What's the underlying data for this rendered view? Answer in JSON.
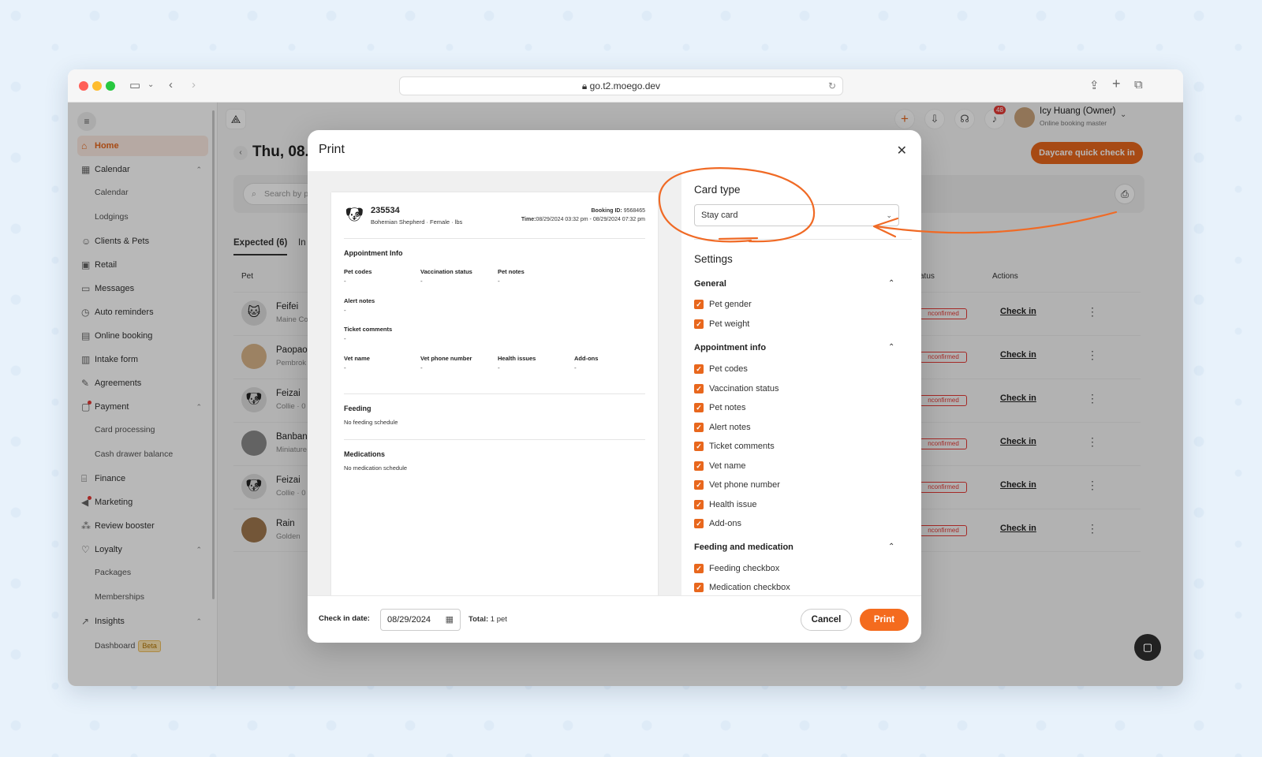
{
  "browser": {
    "url": "go.t2.moego.dev"
  },
  "sidebar": {
    "items": [
      {
        "label": "Home",
        "icon": "home-icon"
      },
      {
        "label": "Calendar",
        "icon": "calendar-icon"
      },
      {
        "label": "Clients & Pets",
        "icon": "users-icon"
      },
      {
        "label": "Retail",
        "icon": "retail-icon"
      },
      {
        "label": "Messages",
        "icon": "message-icon"
      },
      {
        "label": "Auto reminders",
        "icon": "alarm-icon"
      },
      {
        "label": "Online booking",
        "icon": "booking-icon"
      },
      {
        "label": "Intake form",
        "icon": "form-icon"
      },
      {
        "label": "Agreements",
        "icon": "pen-icon"
      },
      {
        "label": "Payment",
        "icon": "payment-icon"
      },
      {
        "label": "Finance",
        "icon": "bank-icon"
      },
      {
        "label": "Marketing",
        "icon": "megaphone-icon"
      },
      {
        "label": "Review booster",
        "icon": "review-icon"
      },
      {
        "label": "Loyalty",
        "icon": "loyalty-icon"
      },
      {
        "label": "Insights",
        "icon": "chart-icon"
      }
    ],
    "sub": {
      "calendar": [
        "Calendar",
        "Lodgings"
      ],
      "payment": [
        "Card processing",
        "Cash drawer balance"
      ],
      "loyalty": [
        "Packages",
        "Memberships"
      ],
      "insights": [
        "Dashboard"
      ]
    },
    "beta": "Beta"
  },
  "header": {
    "notification_count": "48",
    "user_name": "Icy Huang (Owner)",
    "user_role": "Online booking master"
  },
  "page": {
    "date_title": "Thu, 08.",
    "quick_checkin": "Daycare quick check in",
    "search_placeholder": "Search by p",
    "tabs": [
      "Expected (6)",
      "In"
    ],
    "col_pet": "Pet",
    "col_status": "atus",
    "col_actions": "Actions",
    "status_label": "nconfirmed",
    "checkin_label": "Check in",
    "rows": [
      {
        "name": "Feifei",
        "breed": "Maine Co"
      },
      {
        "name": "Paopao",
        "breed": "Pembrok"
      },
      {
        "name": "Feizai",
        "breed": "Collie · 0"
      },
      {
        "name": "Banban",
        "breed": "Miniature"
      },
      {
        "name": "Feizai",
        "breed": "Collie · 0"
      },
      {
        "name": "Rain",
        "breed": "Golden"
      }
    ]
  },
  "modal": {
    "title": "Print",
    "preview": {
      "pet_id": "235534",
      "pet_desc": "Bohemian Shepherd · Female · lbs",
      "booking_label": "Booking ID:",
      "booking_id": "9568465",
      "time_label": "Time:",
      "time_value": "08/29/2024 03:32 pm - 08/29/2024 07:32 pm",
      "appt_info": "Appointment Info",
      "pet_codes": "Pet codes",
      "vacc_status": "Vaccination status",
      "pet_notes": "Pet notes",
      "alert_notes": "Alert notes",
      "ticket_comments": "Ticket comments",
      "vet_name": "Vet name",
      "vet_phone": "Vet phone number",
      "health_issues": "Health issues",
      "addons": "Add-ons",
      "empty": "-",
      "feeding": "Feeding",
      "feeding_note": "No feeding schedule",
      "medications": "Medications",
      "medication_note": "No medication schedule"
    },
    "settings": {
      "card_type_title": "Card type",
      "card_type_value": "Stay card",
      "settings_title": "Settings",
      "groups": [
        {
          "title": "General",
          "items": [
            "Pet gender",
            "Pet weight"
          ]
        },
        {
          "title": "Appointment info",
          "items": [
            "Pet codes",
            "Vaccination status",
            "Pet notes",
            "Alert notes",
            "Ticket comments",
            "Vet name",
            "Vet phone number",
            "Health issue",
            "Add-ons"
          ]
        },
        {
          "title": "Feeding and medication",
          "items": [
            "Feeding checkbox",
            "Medication checkbox"
          ]
        }
      ]
    },
    "footer": {
      "checkin_label": "Check in date:",
      "checkin_date": "08/29/2024",
      "total_label": "Total:",
      "total_value": "1 pet",
      "cancel": "Cancel",
      "print": "Print"
    }
  },
  "colors": {
    "accent": "#e8671d",
    "annotation": "#f06a25"
  }
}
